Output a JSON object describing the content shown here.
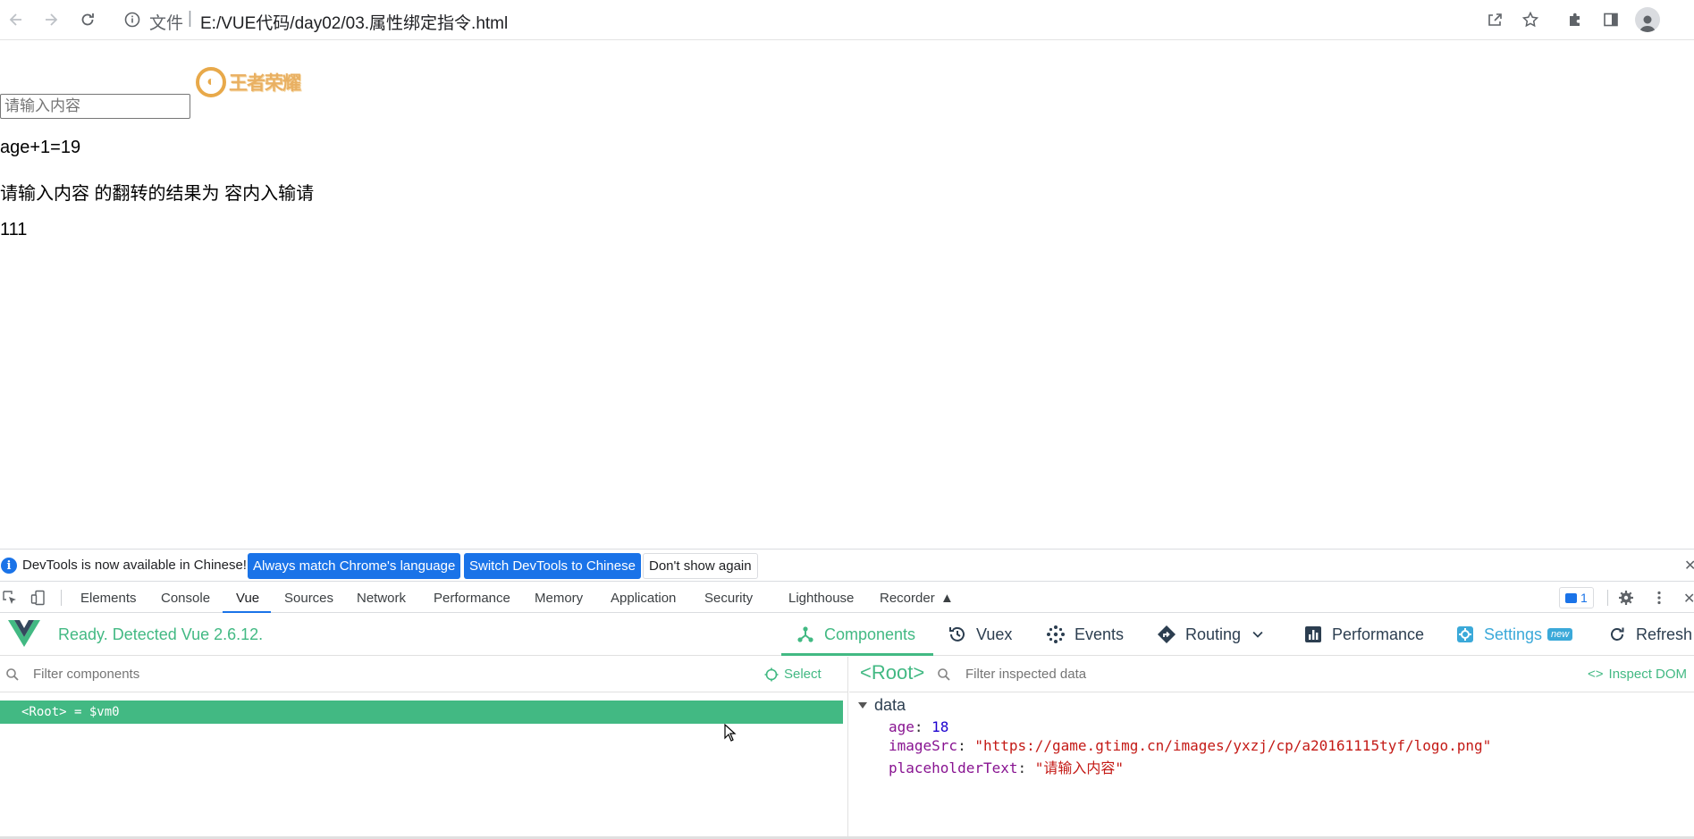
{
  "browser": {
    "url_scheme": "文件",
    "url_sep": "|",
    "url_path": "E:/VUE代码/day02/03.属性绑定指令.html"
  },
  "page": {
    "logo_text": "王者荣耀",
    "input_placeholder": "请输入内容",
    "line1": "age+1=19",
    "line2": "请输入内容 的翻转的结果为 容内入输请",
    "line3": "111"
  },
  "lang_banner": {
    "message": "DevTools is now available in Chinese!",
    "btn_match": "Always match Chrome's language",
    "btn_switch": "Switch DevTools to Chinese",
    "btn_dismiss": "Don't show again",
    "info_glyph": "i",
    "close_glyph": "✕"
  },
  "devtools": {
    "tabs": [
      "Elements",
      "Console",
      "Vue",
      "Sources",
      "Network",
      "Performance",
      "Memory",
      "Application",
      "Security",
      "Lighthouse",
      "Recorder"
    ],
    "active_tab": "Vue",
    "issues_count": "1",
    "close_glyph": "✕"
  },
  "vue": {
    "status": "Ready. Detected Vue 2.6.12.",
    "nav": {
      "components": "Components",
      "vuex": "Vuex",
      "events": "Events",
      "routing": "Routing",
      "performance": "Performance",
      "settings": "Settings",
      "settings_badge": "new",
      "refresh": "Refresh"
    },
    "accent_color": "#42b983",
    "left": {
      "filter_placeholder": "Filter components",
      "select_label": "Select",
      "root_row": "<Root> = $vm0"
    },
    "right": {
      "title": "<Root>",
      "filter_placeholder": "Filter inspected data",
      "inspect_label": "Inspect DOM",
      "section": "data",
      "props": [
        {
          "key": "age",
          "sep": ": ",
          "value": "18",
          "type": "number"
        },
        {
          "key": "imageSrc",
          "sep": ": ",
          "value": "\"https://game.gtimg.cn/images/yxzj/cp/a20161115tyf/logo.png\"",
          "type": "string"
        },
        {
          "key": "placeholderText",
          "sep": ": ",
          "value": "\"请输入内容\"",
          "type": "string"
        }
      ]
    }
  }
}
